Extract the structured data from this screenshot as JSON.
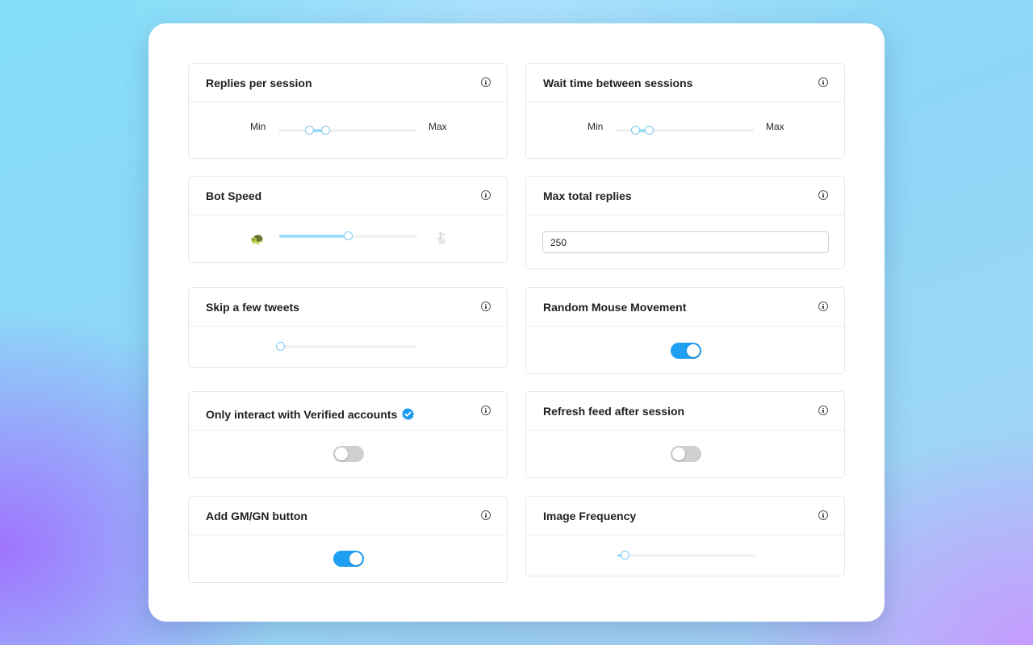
{
  "colors": {
    "accent": "#1e9ff2",
    "slider_fill": "#9fdcf6",
    "slider_knob": "#7cc9ee",
    "verified": "#1d9bf0",
    "toggle_off": "#cfcfcf"
  },
  "cards": {
    "replies_per_session": {
      "title": "Replies per session",
      "min_label": "Min",
      "max_label": "Max",
      "range_value": [
        0.22,
        0.34
      ]
    },
    "wait_time": {
      "title": "Wait time between sessions",
      "min_label": "Min",
      "max_label": "Max",
      "range_value": [
        0.14,
        0.25
      ]
    },
    "bot_speed": {
      "title": "Bot Speed",
      "slow_icon": "turtle-icon",
      "slow_glyph": "🐢",
      "fast_icon": "rabbit-icon",
      "fast_glyph": "🐇",
      "value": 0.5
    },
    "max_total_replies": {
      "title": "Max total replies",
      "value": "250"
    },
    "skip_tweets": {
      "title": "Skip a few tweets",
      "value": 0
    },
    "random_mouse": {
      "title": "Random Mouse Movement",
      "enabled": true
    },
    "verified_only": {
      "title": "Only interact with Verified accounts",
      "badge_icon": "verified-badge-icon",
      "enabled": false
    },
    "refresh_feed": {
      "title": "Refresh feed after session",
      "enabled": false
    },
    "gm_gn_button": {
      "title": "Add GM/GN button",
      "enabled": true
    },
    "image_frequency": {
      "title": "Image Frequency",
      "value": 0.05
    }
  },
  "icons": {
    "info": "info-icon"
  }
}
